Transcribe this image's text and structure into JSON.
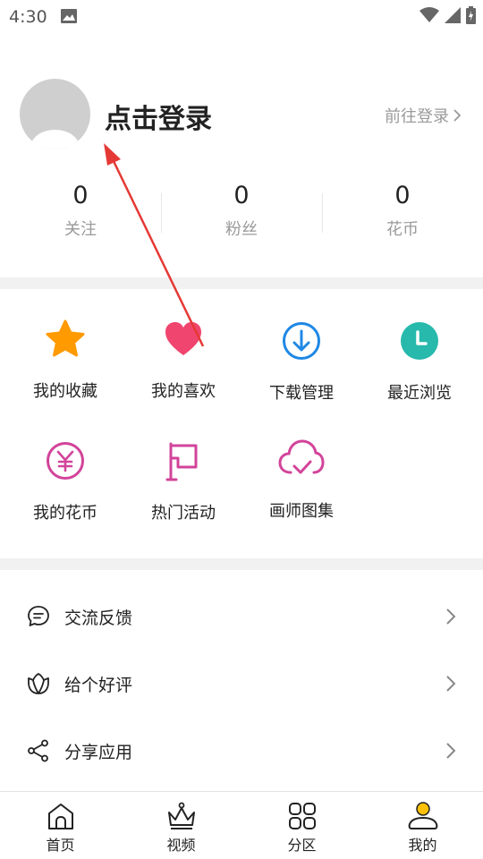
{
  "status_bar": {
    "time": "4:30"
  },
  "profile": {
    "title": "点击登录",
    "goto_login": "前往登录"
  },
  "stats": [
    {
      "value": "0",
      "label": "关注"
    },
    {
      "value": "0",
      "label": "粉丝"
    },
    {
      "value": "0",
      "label": "花币"
    }
  ],
  "grid": [
    {
      "label": "我的收藏",
      "icon": "star-icon",
      "color": "#ff9a00"
    },
    {
      "label": "我的喜欢",
      "icon": "heart-icon",
      "color": "#f0456e"
    },
    {
      "label": "下载管理",
      "icon": "download-icon",
      "color": "#1e88e5"
    },
    {
      "label": "最近浏览",
      "icon": "clock-icon",
      "color": "#26b9ac"
    },
    {
      "label": "我的花币",
      "icon": "yen-icon",
      "color": "#d2449a"
    },
    {
      "label": "热门活动",
      "icon": "flag-icon",
      "color": "#d2449a"
    },
    {
      "label": "画师图集",
      "icon": "cloud-check-icon",
      "color": "#d2449a"
    }
  ],
  "list": [
    {
      "label": "交流反馈",
      "icon": "chat-icon"
    },
    {
      "label": "给个好评",
      "icon": "flower-icon"
    },
    {
      "label": "分享应用",
      "icon": "share-icon"
    }
  ],
  "bottom_nav": [
    {
      "label": "首页",
      "icon": "home-icon"
    },
    {
      "label": "视频",
      "icon": "crown-icon"
    },
    {
      "label": "分区",
      "icon": "grid-icon"
    },
    {
      "label": "我的",
      "icon": "profile-icon",
      "accent": "#ffc107"
    }
  ],
  "annotation": {
    "color": "#e53935"
  }
}
